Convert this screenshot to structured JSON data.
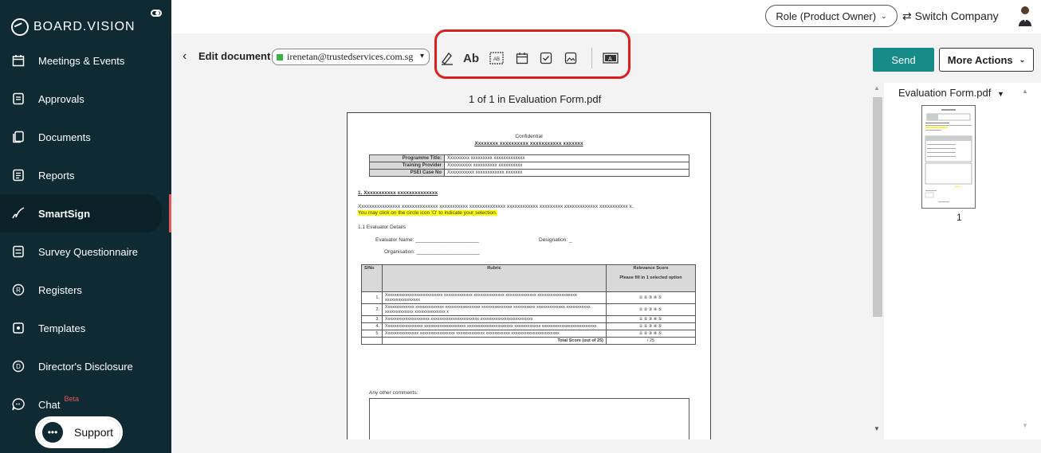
{
  "brand": {
    "name": "BOARD.VISION"
  },
  "sidebar": {
    "items": [
      {
        "label": "Meetings & Events",
        "icon": "calendar-icon"
      },
      {
        "label": "Approvals",
        "icon": "approval-icon"
      },
      {
        "label": "Documents",
        "icon": "documents-icon"
      },
      {
        "label": "Reports",
        "icon": "reports-icon"
      },
      {
        "label": "SmartSign",
        "icon": "signature-icon",
        "active": true
      },
      {
        "label": "Survey Questionnaire",
        "icon": "survey-icon"
      },
      {
        "label": "Registers",
        "icon": "registered-icon"
      },
      {
        "label": "Templates",
        "icon": "templates-icon"
      },
      {
        "label": "Director's Disclosure",
        "icon": "disclosure-icon"
      },
      {
        "label": "Chat",
        "icon": "chat-icon",
        "badge": "Beta"
      }
    ],
    "support_label": "Support"
  },
  "topbar": {
    "role": "Role (Product Owner)",
    "switch_company": "Switch Company"
  },
  "toolbar": {
    "edit_label": "Edit document",
    "signer_email": "irenetan@trustedservices.com.sg",
    "tools": [
      {
        "name": "signature-tool-icon",
        "glyph": "✎"
      },
      {
        "name": "text-tool-icon",
        "glyph": "Ab"
      },
      {
        "name": "stamp-tool-icon",
        "glyph": "AB"
      },
      {
        "name": "date-tool-icon",
        "glyph": "▭"
      },
      {
        "name": "checkbox-tool-icon",
        "glyph": "☑"
      },
      {
        "name": "image-tool-icon",
        "glyph": "▣"
      },
      {
        "name": "textfield-tool-icon",
        "glyph": "A"
      }
    ],
    "send_label": "Send",
    "more_actions_label": "More Actions",
    "accent_color": "#168b87",
    "highlight_color": "#d9201f"
  },
  "viewer": {
    "page_info": "1 of 1 in Evaluation Form.pdf",
    "file_name": "Evaluation Form.pdf",
    "thumb_number": "1"
  },
  "document": {
    "header_small": "Confidential",
    "header_title": "Xxxxxxxx xxxxxxxxxx xxxxxxxxxxx xxxxxxx",
    "info_rows": [
      {
        "label": "Programme Title:",
        "value": "Xxxxxxxxx xxxxxxxxx xxxxxxxxxxxxx"
      },
      {
        "label": "Training Provider",
        "value": "Xxxxxxxxxx xxxxxxxxxx xxxxxxxxxx"
      },
      {
        "label": "PSEI Case No",
        "value": "Xxxxxxxxxxx xxxxxxxxxxxx xxxxxxx"
      }
    ],
    "section1_title": "1.  Xxxxxxxxxxx xxxxxxxxxxxxxx",
    "section1_text": "Xxxxxxxxxxxxxxxx xxxxxxxxxxxxxx xxxxxxxxxxx xxxxxxxxxxxxxx xxxxxxxxxxxx xxxxxxxxx xxxxxxxxxxxxx xxxxxxxxxxx x.",
    "section1_highlight": "You may click on the circle icon 'O'  to indicate your selection.",
    "subsection": "1.1 Evaluator Details",
    "evaluator_name": "Evaluator Name:",
    "designation": "Designation:",
    "organisation": "Organisation:",
    "table_headers": {
      "sno": "S/No",
      "rubric": "Rubric",
      "score": "Relevance Score",
      "score_note": "Please fill in 1 selected option"
    },
    "rows": [
      {
        "no": "1.",
        "text": "Xxxxxxxxxxxxxxxxxxxxxxxxxx xxxxxxxxxxxxx xxxxxxxxxxxxxx xxxxxxxxxxxxxx xxxxxxxxxxxxxxxxxx xxxxxxxxxxxxxxxx",
        "circles": "①②③④⑤"
      },
      {
        "no": "2.",
        "text": "Xxxxxxxxxxxxx xxxxxxxxxxxxx xxxxxxxxxxxxxxxx xxxxxxxxxxxxxx xxxxxxxxxx xxxxxxxxxxxxx xxxxxxxxxxx xxxxxxxxxxxxx xxxxxxxxxxxxxx x",
        "circles": "①②③④⑤"
      },
      {
        "no": "3.",
        "text": "Xxxxxxxxxxxxxxxxxxxx xxxxxxxxxxxxxxxxxxxxxx xxxxxxxxxxxxxxxxxxxxxxxx",
        "circles": "①②③④⑤"
      },
      {
        "no": "4.",
        "text": "Xxxxxxxxxxxxxxxxx xxxxxxxxxxxxxxxxxxx xxxxxxxxxxxxxxxxxxxxx xxxxxxxxxxxx xxxxxxxxxxxxxxxxxxxxxxxxx",
        "circles": "①②③④⑤"
      },
      {
        "no": "5.",
        "text": "Xxxxxxxxxxxxxxx xxxxxxxxxxxxxxxx xxxxxxxxxxxxx xxxxxxxxxxx xxxxxxxxxxxxxxxxxxxxxx",
        "circles": "①②③④⑤"
      }
    ],
    "total_label": "Total Score (out of 25)",
    "total_value": "/ 25",
    "comments_label": "Any other comments:"
  }
}
